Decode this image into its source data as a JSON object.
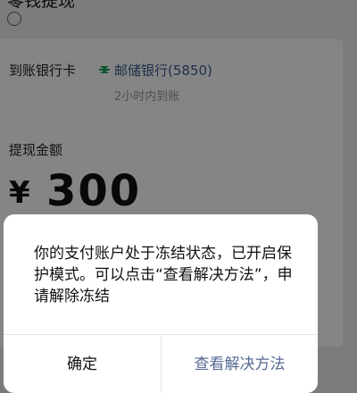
{
  "nav": {
    "title": "零钱提现"
  },
  "form": {
    "bank_label": "到账银行卡",
    "bank_icon": "bank-logo-icon",
    "bank_name": "邮储银行(5850)",
    "arrive_time": "2小时内到账",
    "amount_label": "提现金额",
    "currency": "¥",
    "amount": "300"
  },
  "dialog": {
    "message": "你的支付账户处于冻结状态，已开启保护模式。可以点击“查看解决方法”，申请解除冻结",
    "confirm_label": "确定",
    "solution_label": "查看解决方法"
  },
  "colors": {
    "link_blue": "#576b95",
    "bank_green": "#1aa260"
  }
}
